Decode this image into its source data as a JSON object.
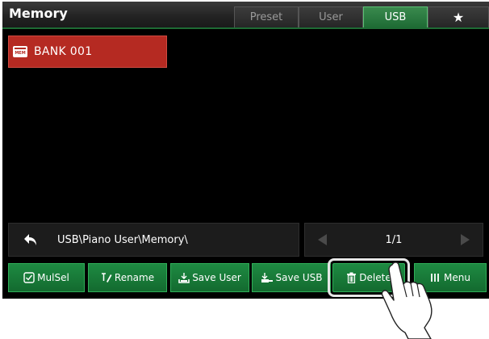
{
  "header": {
    "title": "Memory",
    "tabs": [
      {
        "label": "Preset",
        "active": false
      },
      {
        "label": "User",
        "active": false
      },
      {
        "label": "USB",
        "active": true
      },
      {
        "label": "★",
        "active": false,
        "icon": "star-icon"
      }
    ]
  },
  "files": [
    {
      "icon_text": "MEM",
      "label": "BANK 001",
      "selected": true
    }
  ],
  "path_bar": {
    "path": "USB\\Piano User\\Memory\\",
    "page": "1/1"
  },
  "buttons": [
    {
      "label": "MulSel",
      "icon": "multi-select-icon"
    },
    {
      "label": "Rename",
      "icon": "rename-icon"
    },
    {
      "label": "Save User",
      "icon": "save-user-icon"
    },
    {
      "label": "Save USB",
      "icon": "save-usb-icon"
    },
    {
      "label": "Delete",
      "icon": "trash-icon",
      "highlighted": true
    },
    {
      "label": "Menu",
      "icon": "menu-icon"
    }
  ],
  "colors": {
    "accent_green": "#1e8a42",
    "selected_red": "#b52a22",
    "background": "#000000"
  }
}
